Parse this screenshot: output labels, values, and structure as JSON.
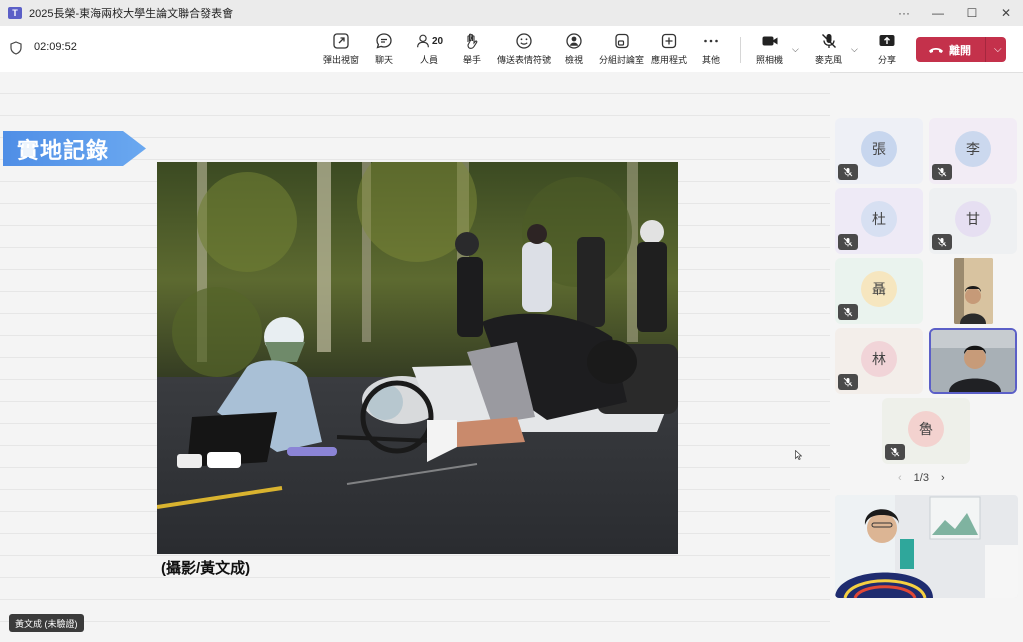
{
  "window": {
    "title": "2025長榮-東海兩校大學生論文聯合發表會",
    "more": "···"
  },
  "toolbar": {
    "timer": "02:09:52",
    "buttons": [
      {
        "label": "彈出視窗",
        "icon": "popout-icon"
      },
      {
        "label": "聊天",
        "icon": "chat-icon"
      },
      {
        "label": "人員",
        "icon": "people-icon",
        "count": "20"
      },
      {
        "label": "舉手",
        "icon": "raise-hand-icon"
      },
      {
        "label": "傳送表情符號",
        "icon": "emoji-icon"
      },
      {
        "label": "檢視",
        "icon": "view-icon"
      },
      {
        "label": "分組討論室",
        "icon": "breakout-icon"
      },
      {
        "label": "應用程式",
        "icon": "apps-icon"
      },
      {
        "label": "其他",
        "icon": "more-icon"
      },
      {
        "label": "照相機",
        "icon": "camera-icon"
      },
      {
        "label": "麥克風",
        "icon": "mic-off-icon"
      },
      {
        "label": "分享",
        "icon": "share-icon"
      }
    ],
    "leave_label": "離開"
  },
  "stage": {
    "ribbon_title": "實地記錄",
    "photo_caption": "(攝影/黃文成)",
    "presenter_tag": "黃文成 (未驗證)"
  },
  "participants": [
    {
      "initial": "張",
      "avatar_color": "#c7d6ee",
      "tile_color": "#eef0f6",
      "muted": true
    },
    {
      "initial": "李",
      "avatar_color": "#cbd8ee",
      "tile_color": "#f2ecf5",
      "muted": true
    },
    {
      "initial": "杜",
      "avatar_color": "#d7e0f2",
      "tile_color": "#eeeaf6",
      "muted": true
    },
    {
      "initial": "甘",
      "avatar_color": "#e6dff2",
      "tile_color": "#eef0f2",
      "muted": true
    },
    {
      "initial": "聶",
      "avatar_color": "#f6e6bf",
      "tile_color": "#eaf3ee",
      "muted": true
    },
    {
      "initial": "林",
      "avatar_color": "#f1d4d8",
      "tile_color": "#f3eeea",
      "muted": true
    },
    {
      "initial": "魯",
      "avatar_color": "#f3d2cf",
      "tile_color": "#eef0ea",
      "muted": true
    }
  ],
  "pager": {
    "text": "1/3",
    "prev": "‹",
    "next": "›"
  }
}
